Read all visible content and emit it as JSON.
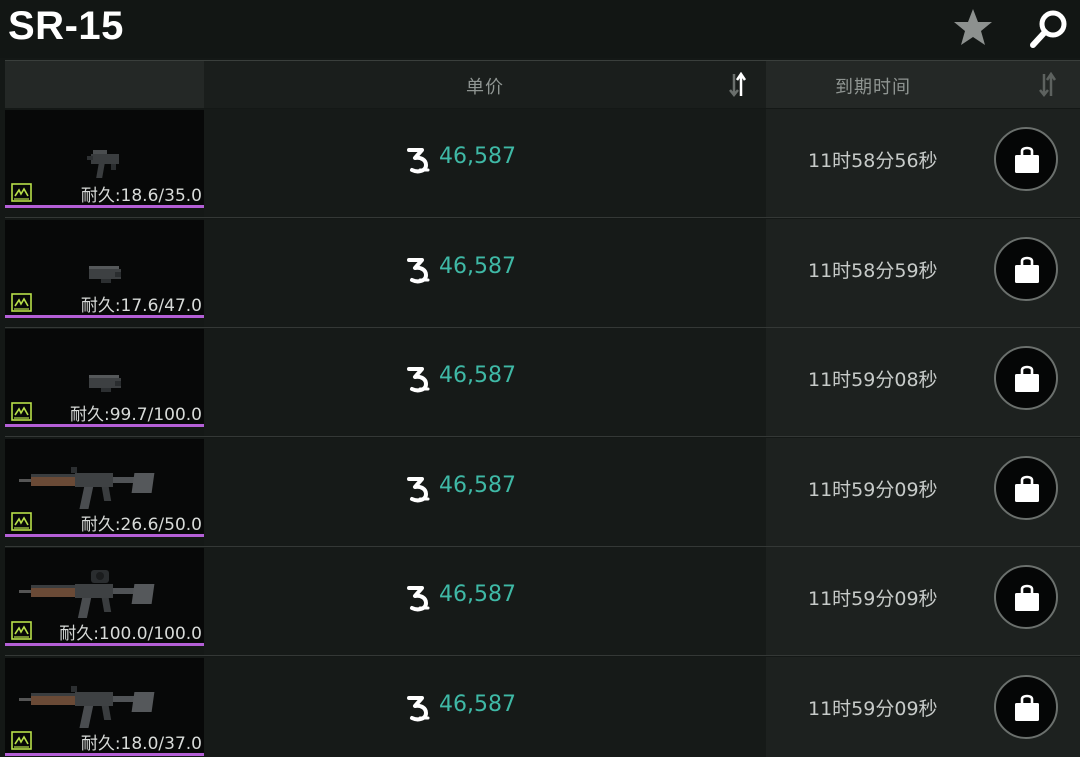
{
  "header": {
    "title": "SR-15"
  },
  "columns": {
    "price_label": "单价",
    "expire_label": "到期时间"
  },
  "colors": {
    "price": "#3fb9a6",
    "rarity_bar": "#b45fd6",
    "background": "#141816"
  },
  "icons": {
    "favorite": "star-icon",
    "search": "search-icon",
    "currency": "coin-icon",
    "buy": "bag-icon",
    "sort": "sort-icon"
  },
  "listings": [
    {
      "item_kind": "receiver",
      "durability": "耐久:18.6/35.0",
      "price": "46,587",
      "expires": "11时58分56秒"
    },
    {
      "item_kind": "upper",
      "durability": "耐久:17.6/47.0",
      "price": "46,587",
      "expires": "11时58分59秒"
    },
    {
      "item_kind": "upper",
      "durability": "耐久:99.7/100.0",
      "price": "46,587",
      "expires": "11时59分08秒"
    },
    {
      "item_kind": "rifle",
      "durability": "耐久:26.6/50.0",
      "price": "46,587",
      "expires": "11时59分09秒"
    },
    {
      "item_kind": "rifle-scoped",
      "durability": "耐久:100.0/100.0",
      "price": "46,587",
      "expires": "11时59分09秒"
    },
    {
      "item_kind": "rifle",
      "durability": "耐久:18.0/37.0",
      "price": "46,587",
      "expires": "11时59分09秒"
    }
  ]
}
